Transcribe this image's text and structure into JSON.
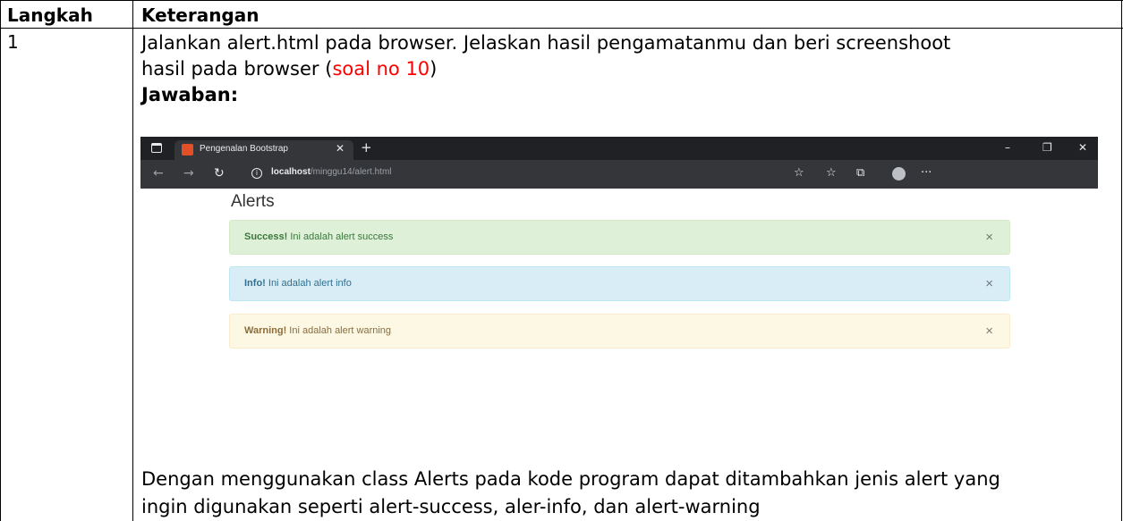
{
  "table": {
    "headers": [
      "Langkah",
      "Keterangan"
    ],
    "step_number": "1",
    "instruction_line1": "Jalankan alert.html pada browser. Jelaskan hasil pengamatanmu dan beri screenshoot",
    "instruction_line2_prefix": "hasil pada browser (",
    "instruction_line2_red": "soal no 10",
    "instruction_line2_suffix": ")",
    "answer_label": "Jawaban:",
    "conclusion_line1": "Dengan menggunakan class Alerts pada kode program dapat ditambahkan jenis alert yang",
    "conclusion_line2": "ingin digunakan seperti alert-success, aler-info, dan alert-warning"
  },
  "browser": {
    "tab_title": "Pengenalan Bootstrap",
    "url_host": "localhost",
    "url_path": "/minggu14/alert.html",
    "icons": [
      "tabs-icon",
      "html-favicon",
      "close-icon",
      "plus-icon",
      "back-icon",
      "forward-icon",
      "refresh-icon",
      "info-icon",
      "star-icon",
      "favorites-icon",
      "collections-icon",
      "profile-icon",
      "more-icon",
      "minimize-icon",
      "restore-icon",
      "close-window-icon"
    ]
  },
  "page": {
    "heading": "Alerts",
    "alerts": [
      {
        "strong": "Success!",
        "text": " Ini adalah alert success",
        "close": "×",
        "color": "#3c763d"
      },
      {
        "strong": "Info!",
        "text": " Ini adalah alert info",
        "close": "×",
        "color": "#31708f"
      },
      {
        "strong": "Warning!",
        "text": " Ini adalah alert warning",
        "close": "×",
        "color": "#8a6d3b"
      }
    ]
  }
}
